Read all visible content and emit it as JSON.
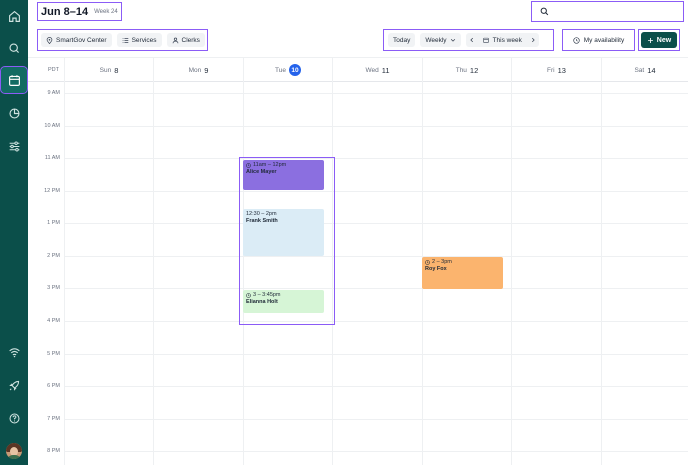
{
  "header": {
    "title": "Jun 8–14",
    "week_label": "Week 24",
    "search_placeholder": ""
  },
  "filters": [
    {
      "label": "SmartGov Center",
      "icon": "location-pin-icon"
    },
    {
      "label": "Services",
      "icon": "list-icon"
    },
    {
      "label": "Clerks",
      "icon": "person-icon"
    }
  ],
  "nav": {
    "today": "Today",
    "view": "Weekly",
    "range": "This week"
  },
  "availability_label": "My availability",
  "new_label": "New",
  "timezone": "PDT",
  "days": [
    {
      "name": "Sun",
      "num": "8"
    },
    {
      "name": "Mon",
      "num": "9"
    },
    {
      "name": "Tue",
      "num": "10",
      "today": true
    },
    {
      "name": "Wed",
      "num": "11"
    },
    {
      "name": "Thu",
      "num": "12"
    },
    {
      "name": "Fri",
      "num": "13"
    },
    {
      "name": "Sat",
      "num": "14"
    }
  ],
  "hours": [
    "9 AM",
    "10 AM",
    "11 AM",
    "12 PM",
    "1 PM",
    "2 PM",
    "3 PM",
    "4 PM",
    "5 PM",
    "6 PM",
    "7 PM",
    "8 PM"
  ],
  "events": [
    {
      "time": "11am – 12pm",
      "who": "Alice Mayer",
      "color": "#8b6fe0"
    },
    {
      "time": "12:30 – 2pm",
      "who": "Frank Smith",
      "color": "#dbecf6"
    },
    {
      "time": "3 – 3:45pm",
      "who": "Elianna Holt",
      "color": "#d6f5d6"
    },
    {
      "time": "2 – 3pm",
      "who": "Roy Fox",
      "color": "#fbb46e"
    }
  ],
  "colors": {
    "sidebar": "#0b4f4a",
    "accent": "#8b5cf6",
    "today": "#2563eb"
  }
}
